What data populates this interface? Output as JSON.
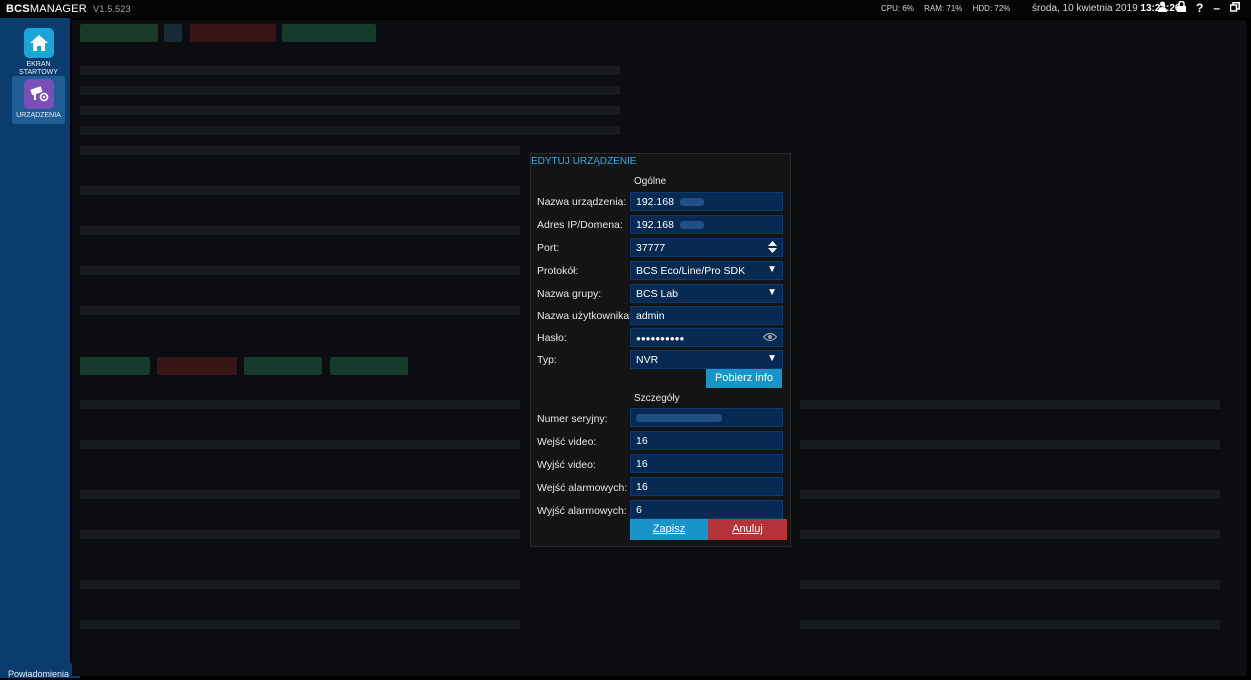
{
  "app": {
    "logo_brand": "BCS",
    "logo_product": "MANAGER",
    "version": "V1.5.523"
  },
  "status": {
    "cpu": "CPU: 6%",
    "ram": "RAM: 71%",
    "hdd": "HDD: 72%",
    "date": "środa, 10 kwietnia 2019",
    "time": "13:23:26"
  },
  "window_controls": [
    "user-icon",
    "lock-icon",
    "help-icon",
    "minimize-icon",
    "restore-icon",
    "close-icon"
  ],
  "sidebar": {
    "items": [
      {
        "label": "EKRAN STARTOWY",
        "icon": "home-icon"
      },
      {
        "label": "URZĄDZENIA",
        "icon": "devices-icon"
      }
    ],
    "notifications": "Powiadomienia"
  },
  "dialog": {
    "title": "EDYTUJ URZĄDZENIE",
    "general_section": "Ogólne",
    "details_section": "Szczegóły",
    "fields": {
      "name_label": "Nazwa urządzenia:",
      "name_value": "192.168",
      "ip_label": "Adres IP/Domena:",
      "ip_value": "192.168",
      "port_label": "Port:",
      "port_value": "37777",
      "protocol_label": "Protokół:",
      "protocol_value": "BCS Eco/Line/Pro SDK",
      "group_label": "Nazwa grupy:",
      "group_value": "BCS Lab",
      "user_label": "Nazwa użytkownika:",
      "user_value": "admin",
      "password_label": "Hasło:",
      "password_value": "●●●●●●●●●●",
      "type_label": "Typ:",
      "type_value": "NVR",
      "fetch_button": "Pobierz info",
      "serial_label": "Numer seryjny:",
      "video_in_label": "Wejść video:",
      "video_in_value": "16",
      "video_out_label": "Wyjść video:",
      "video_out_value": "16",
      "alarm_in_label": "Wejść alarmowych:",
      "alarm_in_value": "16",
      "alarm_out_label": "Wyjść alarmowych:",
      "alarm_out_value": "6"
    },
    "save_button": "Zapisz",
    "cancel_button": "Anuluj"
  }
}
